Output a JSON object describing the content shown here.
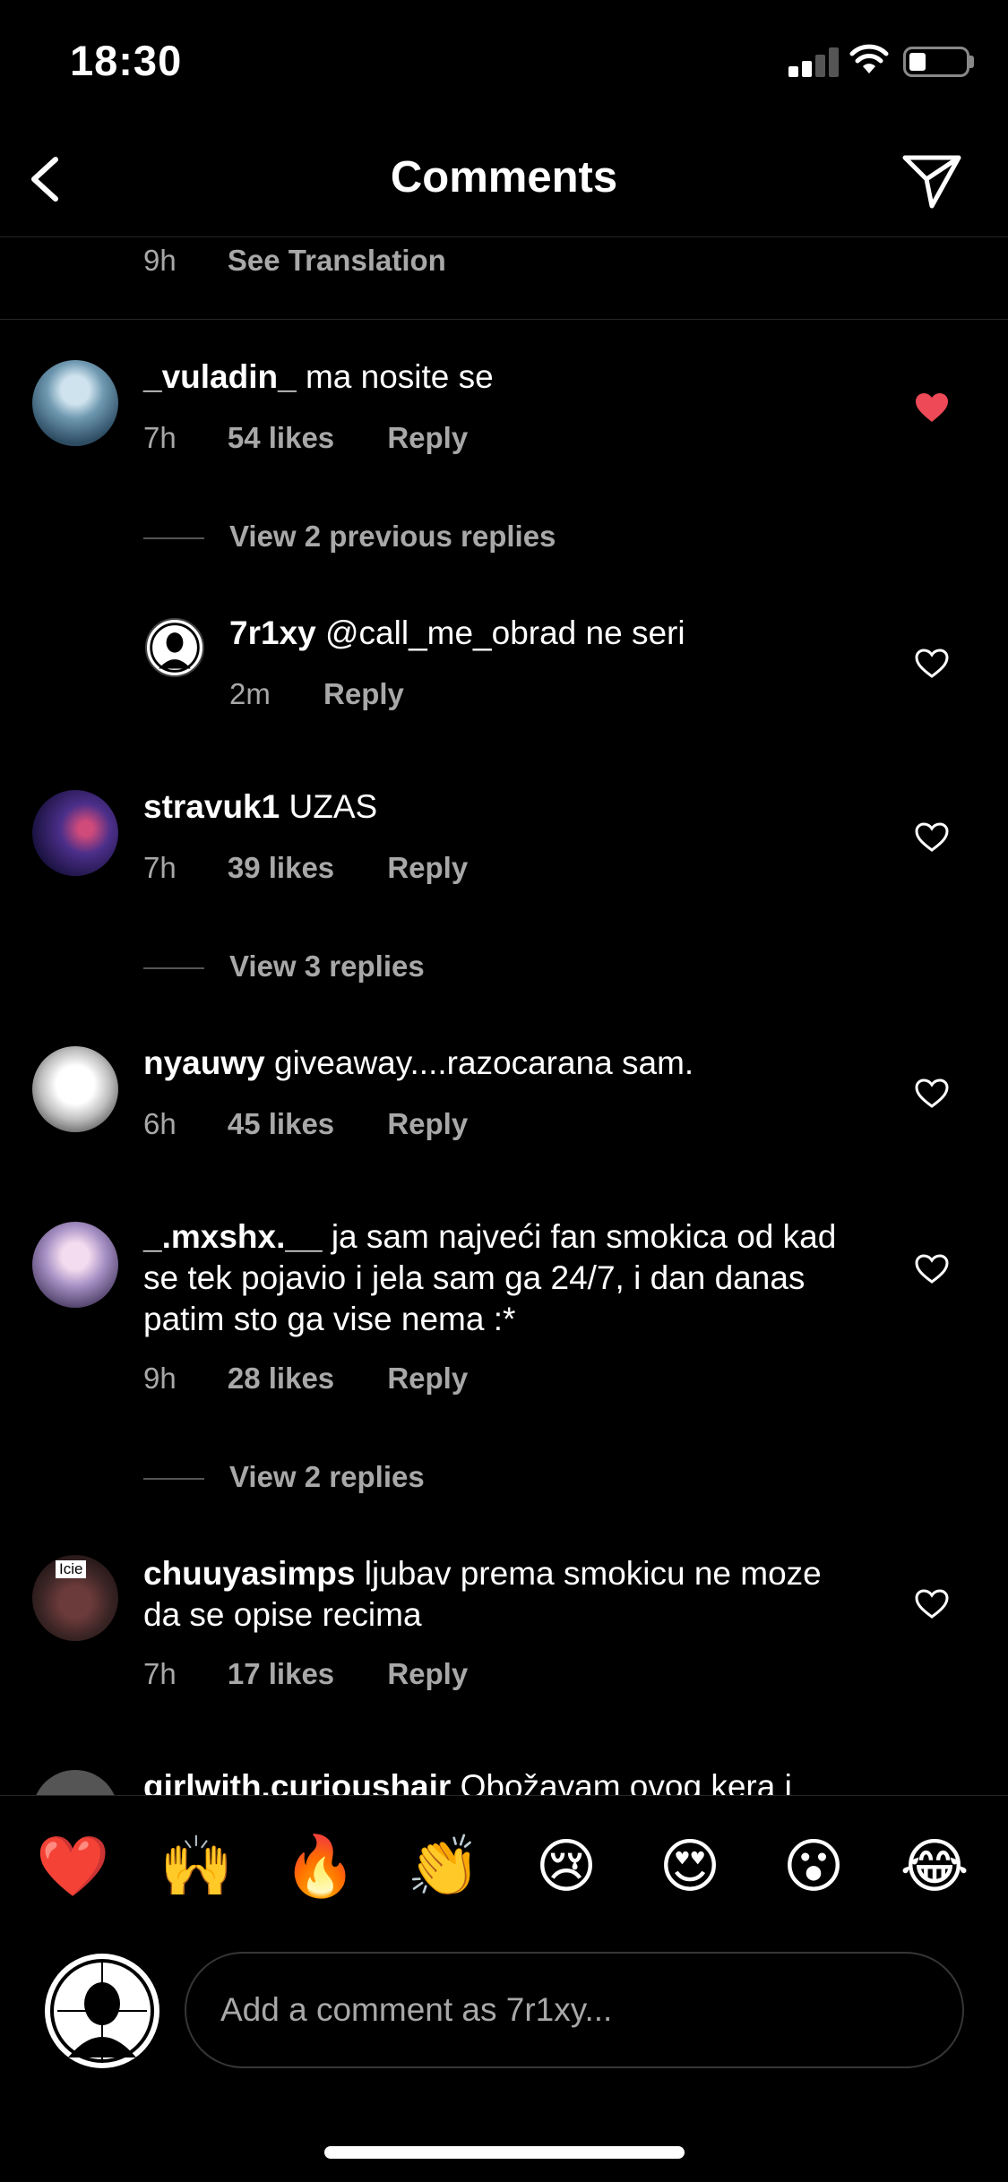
{
  "status_bar": {
    "time": "18:30"
  },
  "nav": {
    "title": "Comments"
  },
  "previous_comment": {
    "time": "9h",
    "see_translation": "See Translation"
  },
  "comments": [
    {
      "user": "_vuladin_",
      "text": "ma nosite se",
      "time": "7h",
      "likes": "54 likes",
      "reply": "Reply",
      "liked": true
    },
    {
      "user": "7r1xy",
      "text": "@call_me_obrad ne seri",
      "time": "2m",
      "reply": "Reply",
      "liked": false
    },
    {
      "user": "stravuk1",
      "text": "UZAS",
      "time": "7h",
      "likes": "39 likes",
      "reply": "Reply",
      "liked": false
    },
    {
      "user": "nyauwy",
      "text": "giveaway....razocarana sam.",
      "time": "6h",
      "likes": "45 likes",
      "reply": "Reply",
      "liked": false
    },
    {
      "user": "_.mxshx.__",
      "text": "ja sam najveći fan smokica od kad se tek pojavio i jela sam ga 24/7, i dan danas patim sto ga vise nema :*",
      "time": "9h",
      "likes": "28 likes",
      "reply": "Reply",
      "liked": false
    },
    {
      "user": "chuuyasimps",
      "text": "ljubav prema smokicu ne moze da se opise recima",
      "time": "7h",
      "likes": "17 likes",
      "reply": "Reply",
      "liked": false,
      "avatar_label": "Icie"
    },
    {
      "user": "girlwith.curioushair",
      "text": "Obožavam ovog kera i"
    }
  ],
  "view_replies": [
    "View 2 previous replies",
    "View 3 replies",
    "View 2 replies"
  ],
  "emojis": [
    "❤️",
    "🙌",
    "🔥",
    "👏",
    "😢",
    "😍",
    "😮",
    "😂"
  ],
  "compose": {
    "placeholder": "Add a comment as 7r1xy..."
  },
  "colors": {
    "background": "#000000",
    "secondary_text": "#a8a8a8",
    "like_red": "#ed4956"
  }
}
